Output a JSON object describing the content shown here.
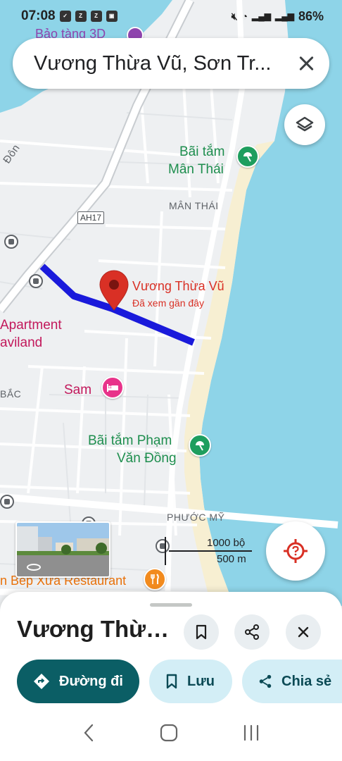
{
  "status_bar": {
    "time": "07:08",
    "battery": "86%",
    "icons": [
      "check-icon",
      "zalo-icon",
      "zalo-icon",
      "image-icon",
      "mute-icon",
      "wifi-icon",
      "signal-lte1-icon",
      "signal-lte2-icon"
    ]
  },
  "search": {
    "query": "Vương Thừa Vũ, Sơn Tr..."
  },
  "map": {
    "labels": {
      "museum": "Bảo tàng 3D",
      "beach_man_thai": [
        "Bãi tắm",
        "Mân Thái"
      ],
      "district_man_thai": "MÂN THÁI",
      "road_shield": "AH17",
      "don": "Đôn",
      "apartment": [
        "Apartment",
        "aviland"
      ],
      "bac": "BẮC",
      "sam": "Sam",
      "beach_pham_van_dong": [
        "Bãi tắm Phạm",
        "Văn Đồng"
      ],
      "phuoc_my": "PHƯỚC MỸ",
      "restaurant": "n Bếp Xưa Restaurant",
      "selected_place": "Vương Thừa Vũ",
      "selected_sub": "Đã xem gần đây"
    },
    "scale": {
      "imperial": "1000 bộ",
      "metric": "500 m"
    },
    "colors": {
      "water": "#8ed4e8",
      "route": "#1a1adb",
      "land": "#eef0f2",
      "beach": "#f7efd2",
      "pin": "#d93025"
    }
  },
  "sheet": {
    "title": "Vương Thừa...",
    "actions": {
      "directions": "Đường đi",
      "save": "Lưu",
      "share": "Chia sẻ"
    }
  },
  "nav": {
    "icons": [
      "back-icon",
      "home-icon",
      "recents-icon"
    ]
  }
}
